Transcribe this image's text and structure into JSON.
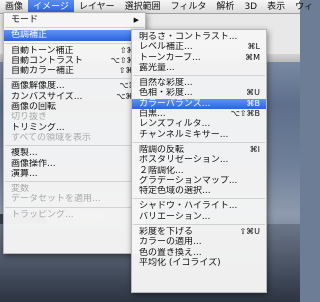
{
  "menubar": {
    "items": [
      {
        "label": "画像",
        "active": false
      },
      {
        "label": "イメージ",
        "active": true
      },
      {
        "label": "レイヤー",
        "active": false
      },
      {
        "label": "選択範囲",
        "active": false
      },
      {
        "label": "フィルタ",
        "active": false
      },
      {
        "label": "解析",
        "active": false
      },
      {
        "label": "3D",
        "active": false
      },
      {
        "label": "表示",
        "active": false
      },
      {
        "label": "ウィ",
        "active": false
      }
    ]
  },
  "image_menu": {
    "items": [
      {
        "label": "モード",
        "arrow": "▶"
      },
      {
        "sep": true
      },
      {
        "label": "色調補正",
        "arrow": "▶",
        "highlight": true
      },
      {
        "sep": true
      },
      {
        "label": "自動トーン補正",
        "shortcut": "⇧⌘L"
      },
      {
        "label": "自動コントラスト",
        "shortcut": "⌥⇧⌘L"
      },
      {
        "label": "自動カラー補正",
        "shortcut": "⇧⌘B"
      },
      {
        "sep": true
      },
      {
        "label": "画像解像度...",
        "shortcut": "⌥⌘I"
      },
      {
        "label": "カンバスサイズ...",
        "shortcut": "⌥⌘C"
      },
      {
        "label": "画像の回転",
        "arrow": "▶"
      },
      {
        "label": "切り抜き",
        "disabled": true
      },
      {
        "label": "トリミング..."
      },
      {
        "label": "すべての領域を表示",
        "disabled": true
      },
      {
        "sep": true
      },
      {
        "label": "複製..."
      },
      {
        "label": "画像操作..."
      },
      {
        "label": "演算..."
      },
      {
        "sep": true
      },
      {
        "label": "変数",
        "arrow": "▶",
        "disabled": true
      },
      {
        "label": "データセットを適用...",
        "disabled": true
      },
      {
        "sep": true
      },
      {
        "label": "トラッピング...",
        "disabled": true
      }
    ]
  },
  "adjust_menu": {
    "items": [
      {
        "label": "明るさ・コントラスト..."
      },
      {
        "label": "レベル補正...",
        "shortcut": "⌘L"
      },
      {
        "label": "トーンカーブ...",
        "shortcut": "⌘M"
      },
      {
        "label": "露光量..."
      },
      {
        "sep": true
      },
      {
        "label": "自然な彩度..."
      },
      {
        "label": "色相・彩度...",
        "shortcut": "⌘U"
      },
      {
        "label": "カラーバランス...",
        "shortcut": "⌘B",
        "highlight": true
      },
      {
        "label": "白黒...",
        "shortcut": "⌥⇧⌘B"
      },
      {
        "label": "レンズフィルタ..."
      },
      {
        "label": "チャンネルミキサー..."
      },
      {
        "sep": true
      },
      {
        "label": "階調の反転",
        "shortcut": "⌘I"
      },
      {
        "label": "ポスタリゼーション..."
      },
      {
        "label": "２階調化..."
      },
      {
        "label": "グラデーションマップ..."
      },
      {
        "label": "特定色域の選択..."
      },
      {
        "sep": true
      },
      {
        "label": "シャドウ・ハイライト..."
      },
      {
        "label": "バリエーション..."
      },
      {
        "sep": true
      },
      {
        "label": "彩度を下げる",
        "shortcut": "⇧⌘U"
      },
      {
        "label": "カラーの適用..."
      },
      {
        "label": "色の置き換え..."
      },
      {
        "label": "平均化 (イコライズ)"
      }
    ]
  }
}
